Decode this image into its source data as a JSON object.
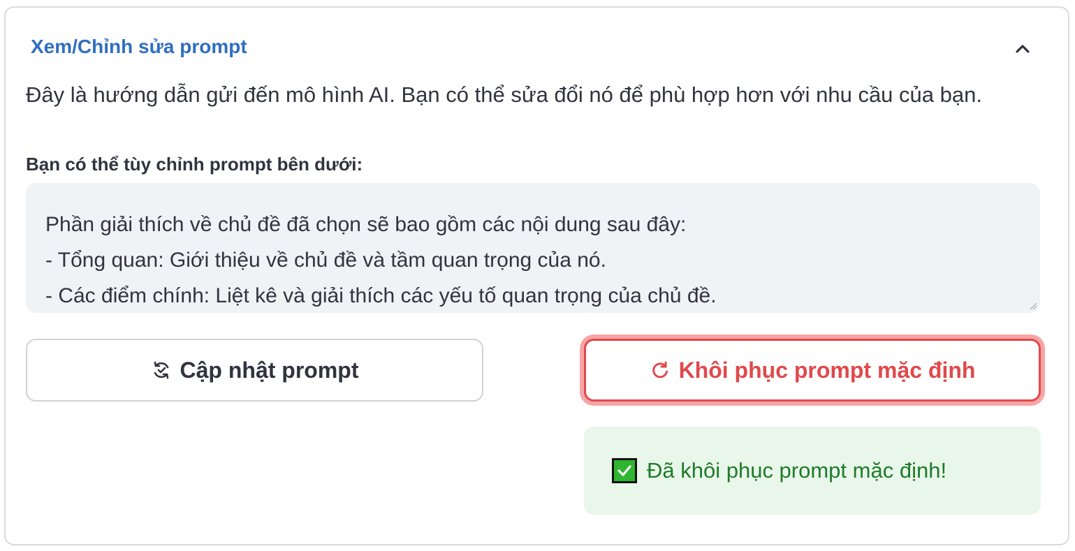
{
  "expander": {
    "title": "Xem/Chỉnh sửa prompt",
    "toggle_icon": "chevron-up-icon"
  },
  "description": "Đây là hướng dẫn gửi đến mô hình AI. Bạn có thể sửa đổi nó để phù hợp hơn với nhu cầu của bạn.",
  "prompt_field": {
    "label": "Bạn có thể tùy chỉnh prompt bên dưới:",
    "lines": [
      "Phần giải thích về chủ đề đã chọn sẽ bao gồm các nội dung sau đây:",
      "- Tổng quan: Giới thiệu về chủ đề và tầm quan trọng của nó.",
      "- Các điểm chính: Liệt kê và giải thích các yếu tố quan trọng của chủ đề."
    ]
  },
  "buttons": {
    "update": {
      "label": "Cập nhật prompt",
      "icon": "sync-icon"
    },
    "reset": {
      "label": "Khôi phục prompt mặc định",
      "icon": "refresh-icon",
      "color": "#e0494b"
    }
  },
  "alert": {
    "icon": "check-mark-icon",
    "text": "Đã khôi phục prompt mặc định!",
    "color": "#1f7a2b",
    "background": "#e9f7ea"
  }
}
